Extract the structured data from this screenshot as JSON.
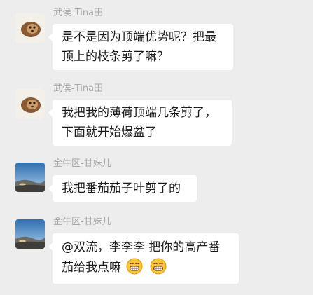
{
  "messages": [
    {
      "sender": "武侯-Tina田",
      "avatar": "lion-avatar",
      "lines": [
        "是不是因为顶端优势呢？把最",
        "顶上的枝条剪了嘛？"
      ]
    },
    {
      "sender": "武侯-Tina田",
      "avatar": "lion-avatar",
      "lines": [
        "我把我的薄荷顶端几条剪了，",
        "下面就开始爆盆了"
      ]
    },
    {
      "sender": "金牛区-甘妹儿",
      "avatar": "landscape-avatar",
      "lines": [
        "我把番茄茄子叶剪了的"
      ]
    },
    {
      "sender": "金牛区-甘妹儿",
      "avatar": "landscape-avatar",
      "lines": [
        "@双流，李李李 把你的高产番",
        "茄给我点嘛"
      ],
      "trailing_emojis": [
        "grin-emoji",
        "grin-emoji"
      ]
    }
  ],
  "colors": {
    "background": "#ededed",
    "bubble": "#ffffff",
    "sender_text": "#a8a8a8",
    "message_text": "#1a1a1a"
  }
}
